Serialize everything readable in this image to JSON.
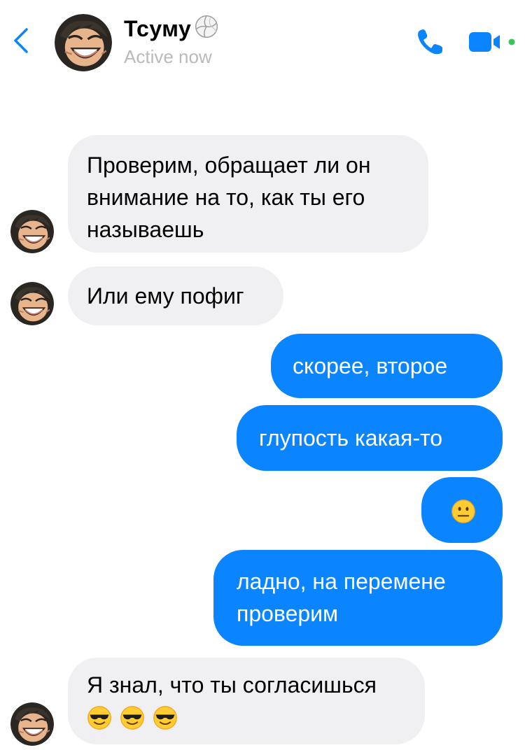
{
  "header": {
    "contact_name": "Тсуму",
    "status": "Active now"
  },
  "icons": {
    "back": "chevron-left-icon",
    "call": "phone-icon",
    "video": "video-camera-icon",
    "name_badge": "volleyball-icon",
    "neutral": "neutral-face-emoji",
    "cool": "sunglasses-face-emoji"
  },
  "colors": {
    "accent": "#0a84ff",
    "incoming_bubble": "#f0f0f2",
    "status_text": "#b9b9be"
  },
  "messages": [
    {
      "from": "contact",
      "text": "Проверим, обращает ли он внимание на то, как ты его называешь"
    },
    {
      "from": "contact",
      "text": "Или ему пофиг"
    },
    {
      "from": "me",
      "text": "скорее, второе"
    },
    {
      "from": "me",
      "text": "глупость какая-то"
    },
    {
      "from": "me",
      "emoji": "neutral-face"
    },
    {
      "from": "me",
      "text": "ладно, на перемене проверим"
    },
    {
      "from": "contact",
      "text": "Я знал, что ты согласишься",
      "emoji": [
        "sunglasses-face",
        "sunglasses-face",
        "sunglasses-face"
      ]
    }
  ]
}
